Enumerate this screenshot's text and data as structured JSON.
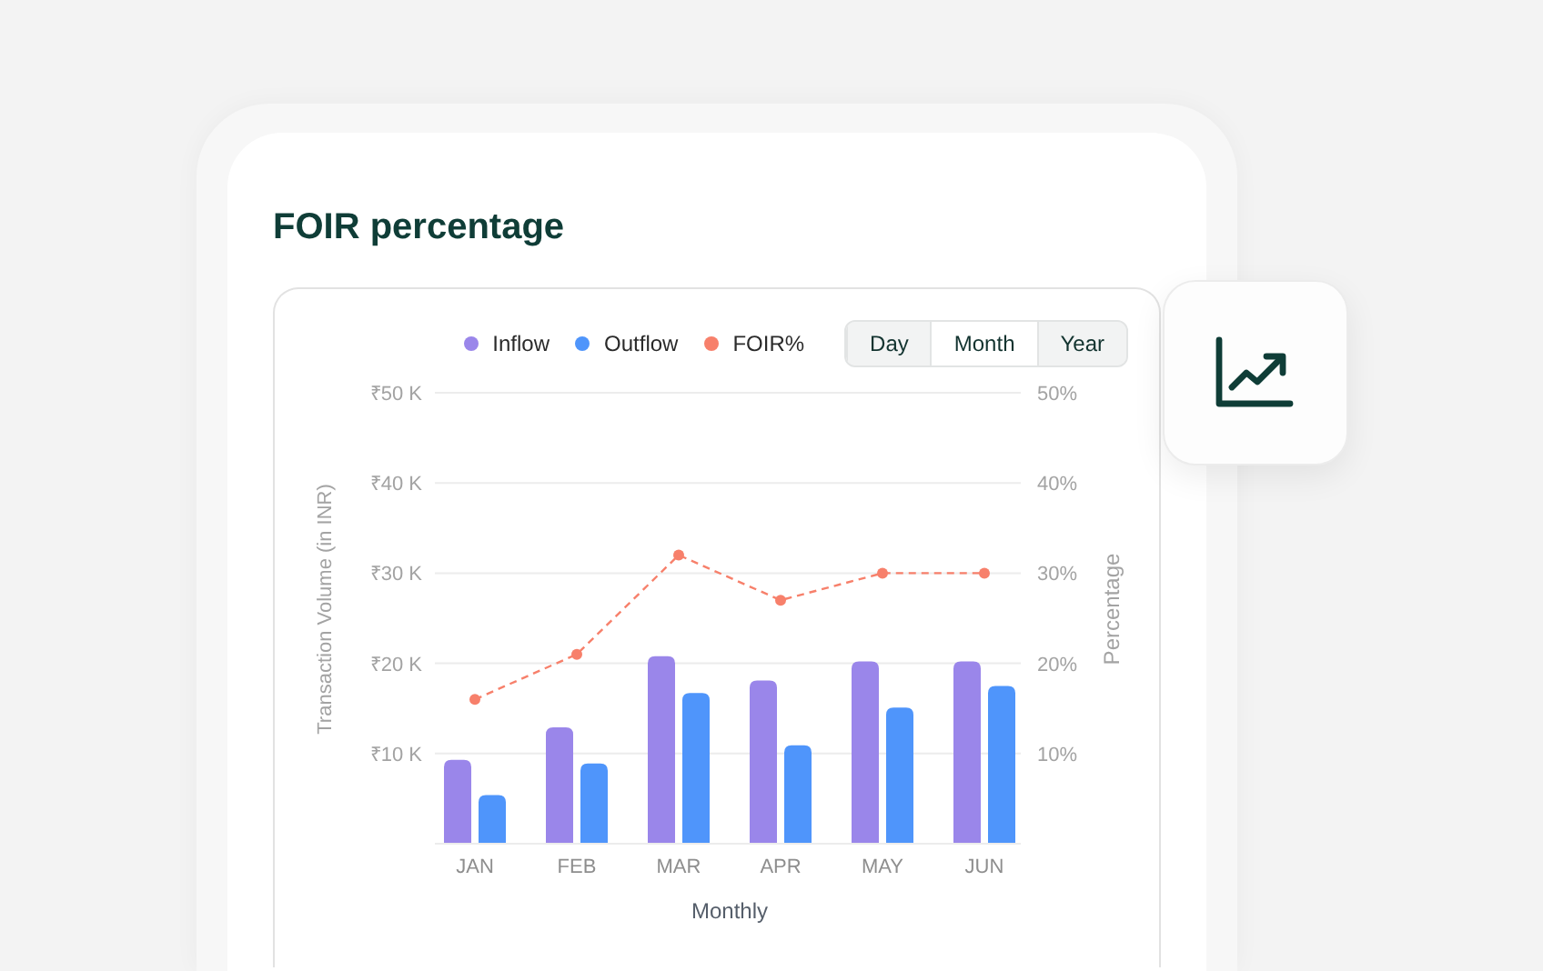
{
  "card": {
    "title": "FOIR percentage"
  },
  "period_tabs": [
    {
      "label": "Day",
      "selected": false
    },
    {
      "label": "Month",
      "selected": true
    },
    {
      "label": "Year",
      "selected": false
    }
  ],
  "volume_chart": {
    "chart_data": {
      "type": "bar",
      "xlabel": "Monthly",
      "ylabel": "Transaction Volume (in INR)",
      "grid": true,
      "categories": [
        "JAN",
        "FEB",
        "MAR",
        "APR",
        "MAY",
        "JUN"
      ],
      "ylim": [
        0,
        50000
      ],
      "yticks": [
        {
          "value": 10000,
          "label": "₹10 K"
        },
        {
          "value": 20000,
          "label": "₹20 K"
        },
        {
          "value": 30000,
          "label": "₹30 K"
        },
        {
          "value": 40000,
          "label": "₹40 K"
        },
        {
          "value": 50000,
          "label": "₹50 K"
        }
      ],
      "series": [
        {
          "name": "Inflow",
          "color": "#9a86ea",
          "values": [
            9300,
            12900,
            20800,
            18100,
            20200,
            20200
          ]
        },
        {
          "name": "Outflow",
          "color": "#4f95fb",
          "values": [
            5400,
            8900,
            16700,
            10900,
            15100,
            17500
          ]
        }
      ]
    }
  },
  "foir_chart": {
    "chart_data": {
      "type": "line",
      "ylabel": "Percentage",
      "ylim": [
        0,
        50
      ],
      "yticks": [
        {
          "value": 10,
          "label": "10%"
        },
        {
          "value": 20,
          "label": "20%"
        },
        {
          "value": 30,
          "label": "30%"
        },
        {
          "value": 40,
          "label": "40%"
        },
        {
          "value": 50,
          "label": "50%"
        }
      ],
      "series": [
        {
          "name": "FOIR%",
          "color": "#f7806b",
          "line_style": "dashed",
          "marker": "circle",
          "values": [
            16,
            21,
            32,
            27,
            30,
            30
          ]
        }
      ]
    }
  }
}
